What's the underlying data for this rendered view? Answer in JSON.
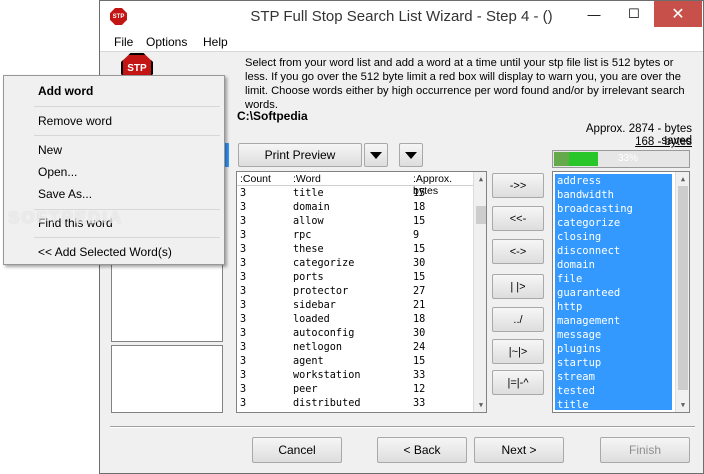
{
  "window": {
    "title": "STP Full Stop Search List Wizard - Step 4 - ()",
    "icon_text": "STP",
    "minimize": "—",
    "maximize": "☐",
    "close": "✕"
  },
  "menu": {
    "file": "File",
    "options": "Options",
    "help": "Help"
  },
  "logo_text": "STP",
  "instructions": "Select from your word list and add a word at a time until your stp file list is 512 bytes or less. If you go over the 512 byte limit a red box will display to warn you, you are over the limit. Choose words either by high occurrence per word found and/or by irrelevant search words.",
  "path": "C:\\Softpedia",
  "bytes_saved": "Approx. 2874 - bytes saved",
  "bytes_used": "168 - bytes",
  "progress": {
    "label": "33%",
    "value": 0.33
  },
  "toolbar": {
    "print_preview": "Print Preview"
  },
  "word_table": {
    "headers": [
      ":Count",
      ":Word",
      ":Approx. bytes"
    ],
    "rows": [
      [
        "3",
        "title",
        "15"
      ],
      [
        "3",
        "domain",
        "18"
      ],
      [
        "3",
        "allow",
        "15"
      ],
      [
        "3",
        "rpc",
        "9"
      ],
      [
        "3",
        "these",
        "15"
      ],
      [
        "3",
        "categorize",
        "30"
      ],
      [
        "3",
        "ports",
        "15"
      ],
      [
        "3",
        "protector",
        "27"
      ],
      [
        "3",
        "sidebar",
        "21"
      ],
      [
        "3",
        "loaded",
        "18"
      ],
      [
        "3",
        "autoconfig",
        "30"
      ],
      [
        "3",
        "netlogon",
        "24"
      ],
      [
        "3",
        "agent",
        "15"
      ],
      [
        "3",
        "workstation",
        "33"
      ],
      [
        "3",
        "peer",
        "12"
      ],
      [
        "3",
        "distributed",
        "33"
      ]
    ]
  },
  "middle_buttons": [
    "->>",
    "<<-",
    "<->",
    "| |>",
    "../",
    "|~|>",
    "|=|-^"
  ],
  "stop_list": [
    "address",
    "bandwidth",
    "broadcasting",
    "categorize",
    "closing",
    "disconnect",
    "domain",
    "file",
    "guaranteed",
    "http",
    "management",
    "message",
    "plugins",
    "startup",
    "stream",
    "tested",
    "title"
  ],
  "nav": {
    "cancel": "Cancel",
    "back": "< Back",
    "next": "Next >",
    "finish": "Finish"
  },
  "context_menu": {
    "add_word": "Add word",
    "remove_word": "Remove word",
    "new": "New",
    "open": "Open...",
    "save_as": "Save As...",
    "find_word": "Find this word",
    "add_selected": "<< Add Selected Word(s)"
  },
  "watermark": "SOFTPEDIA"
}
